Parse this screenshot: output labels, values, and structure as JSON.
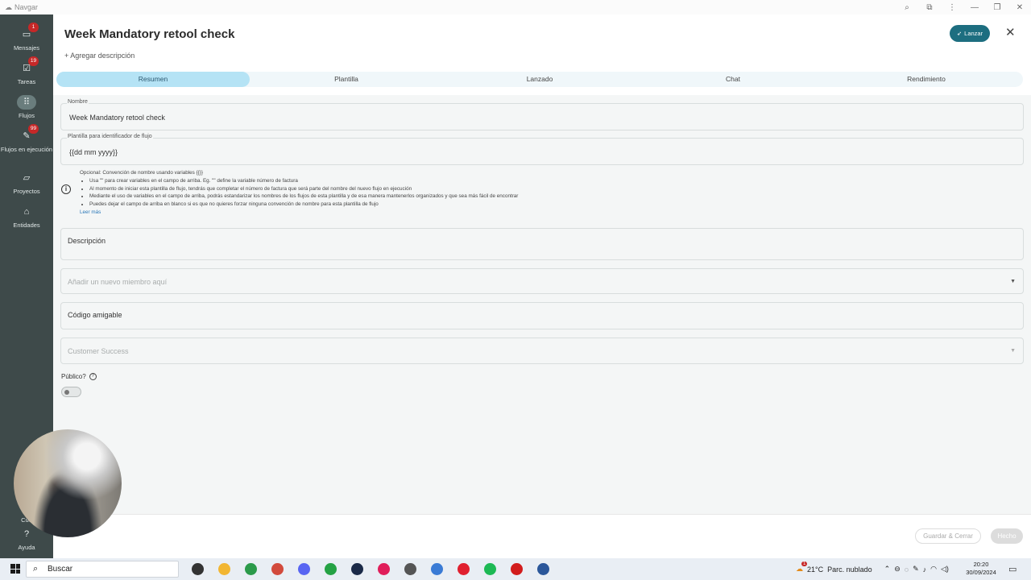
{
  "window": {
    "app_title": "Navgar"
  },
  "sidebar": {
    "items": [
      {
        "label": "Mensajes",
        "badge": "1"
      },
      {
        "label": "Tareas",
        "badge": "19"
      },
      {
        "label": "Flujos",
        "badge": ""
      },
      {
        "label": "Flujos en ejecución",
        "badge": "99"
      },
      {
        "label": "Proyectos",
        "badge": ""
      },
      {
        "label": "Entidades",
        "badge": ""
      },
      {
        "label": "Cue",
        "badge": ""
      },
      {
        "label": "Ayuda",
        "badge": ""
      }
    ]
  },
  "header": {
    "title": "Week Mandatory retool check",
    "add_description": "+ Agregar descripción",
    "launch_label": "Lanzar"
  },
  "tabs": [
    "Resumen",
    "Plantilla",
    "Lanzado",
    "Chat",
    "Rendimiento"
  ],
  "form": {
    "name_label": "Nombre",
    "name_value": "Week Mandatory retool check",
    "template_label": "Plantilla para identificador de flujo",
    "template_value": "{{dd mm yyyy}}",
    "info": {
      "heading": "Opcional: Convención de nombre usando variables {{}}",
      "bullets": [
        "Usa \"\" para crear variables en el campo de arriba. Eg. \"\" define la variable número de factura",
        "Al momento de iniciar esta plantilla de flujo, tendrás que completar el número de factura que será parte del nombre del nuevo flujo en ejecución",
        "Mediante el uso de variables en el campo de arriba, podrás estandarizar los nombres de los flujos de esta plantilla y de esa manera mantenerlos organizados y que sea más fácil de encontrar",
        "Puedes dejar el campo de arriba en blanco si es que no quieres forzar ninguna convención de nombre para esta plantilla de flujo"
      ],
      "read_more": "Leer más"
    },
    "description_label": "Descripción",
    "member_placeholder": "Añadir un nuevo miembro aquí",
    "friendly_code_label": "Código amigable",
    "team_placeholder": "Customer Success",
    "public_label": "Público?",
    "public_enabled": false
  },
  "footer": {
    "save_close_label": "Guardar & Cerrar",
    "done_label": "Hecho"
  },
  "taskbar": {
    "search_label": "Buscar",
    "weather_temp": "21°C",
    "weather_desc": "Parc. nublado",
    "weather_badge": "1",
    "time": "20:20",
    "date": "30/09/2024",
    "apps": [
      {
        "name": "task-view-icon",
        "color": "#333333"
      },
      {
        "name": "file-explorer-icon",
        "color": "#f2b632"
      },
      {
        "name": "chrome-icon",
        "color": "#2b9a4a"
      },
      {
        "name": "chrome-profile-icon",
        "color": "#d24a3c"
      },
      {
        "name": "discord-icon",
        "color": "#5865f2"
      },
      {
        "name": "whatsapp-icon",
        "color": "#25a244"
      },
      {
        "name": "steam-icon",
        "color": "#1b2a48"
      },
      {
        "name": "slack-icon",
        "color": "#e01e5a"
      },
      {
        "name": "cloud-app-icon",
        "color": "#555555"
      },
      {
        "name": "chrome-secondary-icon",
        "color": "#3a7bd5"
      },
      {
        "name": "opera-icon",
        "color": "#e0202f"
      },
      {
        "name": "spotify-icon",
        "color": "#1db954"
      },
      {
        "name": "acrobat-icon",
        "color": "#d21c1c"
      },
      {
        "name": "word-icon",
        "color": "#2b579a"
      }
    ]
  },
  "colors": {
    "sidebar_bg": "#3e4a4a",
    "accent": "#1d6e80",
    "active_tab": "#b5e3f5",
    "badge": "#c62828"
  }
}
